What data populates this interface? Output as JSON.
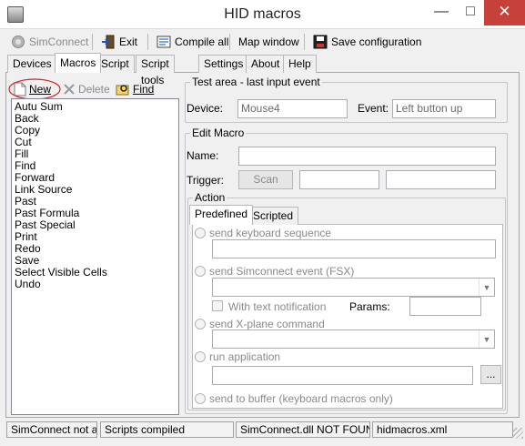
{
  "window": {
    "title": "HID macros"
  },
  "toolbar": {
    "simconnect": "SimConnect",
    "exit": "Exit",
    "compile_all": "Compile all",
    "map_window": "Map window",
    "save_configuration": "Save configuration"
  },
  "tabs": [
    "Devices",
    "Macros",
    "Script",
    "Script tools",
    "Settings",
    "About",
    "Help"
  ],
  "active_tab": "Macros",
  "list_toolbar": {
    "new": "New",
    "delete": "Delete",
    "find": "Find"
  },
  "macros": [
    "Autu Sum",
    "Back",
    "Copy",
    "Cut",
    "Fill",
    "Find",
    "Forward",
    "Link Source",
    "Past",
    "Past Formula",
    "Past Special",
    "Print",
    "Redo",
    "Save",
    "Select Visible Cells",
    "Undo"
  ],
  "test_area": {
    "title": "Test area - last input event",
    "device_label": "Device:",
    "device_value": "Mouse4",
    "event_label": "Event:",
    "event_value": "Left button up"
  },
  "edit_macro": {
    "title": "Edit Macro",
    "name_label": "Name:",
    "name_value": "",
    "trigger_label": "Trigger:",
    "scan": "Scan"
  },
  "action": {
    "title": "Action",
    "tabs": [
      "Predefined",
      "Scripted"
    ],
    "active_tab": "Predefined",
    "send_keyboard": "send keyboard sequence",
    "send_simconnect": "send Simconnect event (FSX)",
    "with_text_notification": "With text notification",
    "params_label": "Params:",
    "send_xplane": "send X-plane command",
    "run_application": "run application",
    "browse": "...",
    "send_to_buffer": "send to buffer (keyboard macros only)"
  },
  "statusbar": [
    "SimConnect not av",
    "Scripts compiled",
    "SimConnect.dll NOT FOUN",
    "hidmacros.xml"
  ],
  "colors": {
    "close_button": "#c7403a",
    "annotation_circle": "#d0232a"
  }
}
